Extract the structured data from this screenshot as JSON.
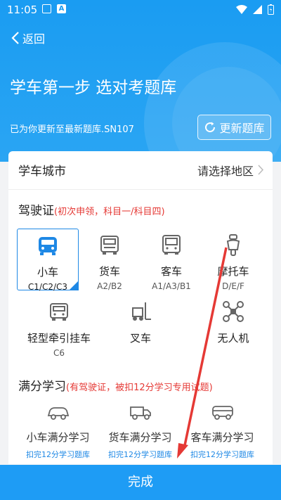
{
  "status_bar": {
    "time": "11:05",
    "icon_a": "A"
  },
  "header": {
    "back_label": "返回",
    "title": "学车第一步 选对考题库",
    "subtitle": "已为你更新至最新题库.SN107",
    "update_button": "更新题库"
  },
  "city": {
    "label": "学车城市",
    "value": "请选择地区"
  },
  "license": {
    "title": "驾驶证",
    "note": "(初次申领，科目一/科目四)",
    "items": [
      {
        "name": "小车",
        "sub": "C1/C2/C3",
        "icon": "car-icon",
        "selected": true
      },
      {
        "name": "货车",
        "sub": "A2/B2",
        "icon": "truck-icon"
      },
      {
        "name": "客车",
        "sub": "A1/A3/B1",
        "icon": "bus-icon"
      },
      {
        "name": "摩托车",
        "sub": "D/E/F",
        "icon": "motorcycle-icon"
      },
      {
        "name": "轻型牵引挂车",
        "sub": "C6",
        "icon": "trailer-icon"
      },
      {
        "name": "叉车",
        "sub": "",
        "icon": "forklift-icon"
      },
      {
        "name": "无人机",
        "sub": "",
        "icon": "drone-icon"
      }
    ]
  },
  "full_score": {
    "title": "满分学习",
    "note": "(有驾驶证，被扣12分学习专用试题)",
    "items": [
      {
        "name": "小车满分学习",
        "link": "扣完12分学习题库",
        "icon": "car-outline-icon"
      },
      {
        "name": "货车满分学习",
        "link": "扣完12分学习题库",
        "icon": "truck-outline-icon"
      },
      {
        "name": "客车满分学习",
        "link": "扣完12分学习题库",
        "icon": "bus-outline-icon"
      }
    ]
  },
  "done_button": "完成",
  "colors": {
    "primary": "#1a9cf2",
    "accent": "#1e88e5",
    "note": "#e53935",
    "annotation_arrow": "#e53935"
  }
}
